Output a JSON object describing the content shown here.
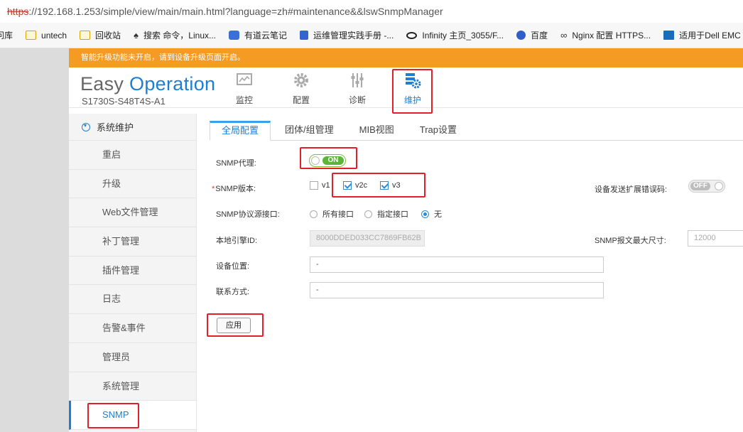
{
  "browser": {
    "url_proto": "https",
    "url_rest": "://192.168.1.253/simple/view/main/main.html?language=zh#maintenance&&lswSnmpManager",
    "bookmarks": [
      {
        "label": "问库",
        "icon": "none"
      },
      {
        "label": "untech",
        "icon": "folder-icon"
      },
      {
        "label": "回收站",
        "icon": "folder-icon"
      },
      {
        "label": "搜索 命令，Linux...",
        "icon": "linux-penguin-icon"
      },
      {
        "label": "有道云笔记",
        "icon": "youdao-note-icon"
      },
      {
        "label": "运维管理实践手册 -...",
        "icon": "document-icon"
      },
      {
        "label": "Infinity 主页_3055/F...",
        "icon": "infinity-icon"
      },
      {
        "label": "百度",
        "icon": "baidu-paw-icon"
      },
      {
        "label": "Nginx 配置 HTTPS...",
        "icon": "nginx-icon"
      },
      {
        "label": "适用于Dell EMC",
        "icon": "dell-icon"
      }
    ]
  },
  "banner": {
    "text": "智能升级功能未开启，请到设备升级页面开启。"
  },
  "header": {
    "brand_easy": "Easy",
    "brand_operation": "Operation",
    "model": "S1730S-S48T4S-A1",
    "nav": [
      {
        "label": "监控",
        "icon": "monitor-icon",
        "active": false
      },
      {
        "label": "配置",
        "icon": "gear-icon",
        "active": false
      },
      {
        "label": "诊断",
        "icon": "sliders-icon",
        "active": false
      },
      {
        "label": "维护",
        "icon": "maintenance-icon",
        "active": true
      }
    ]
  },
  "sidebar": {
    "section": "系统维护",
    "items": [
      {
        "label": "重启",
        "active": false
      },
      {
        "label": "升级",
        "active": false
      },
      {
        "label": "Web文件管理",
        "active": false
      },
      {
        "label": "补丁管理",
        "active": false
      },
      {
        "label": "插件管理",
        "active": false
      },
      {
        "label": "日志",
        "active": false
      },
      {
        "label": "告警&事件",
        "active": false
      },
      {
        "label": "管理员",
        "active": false
      },
      {
        "label": "系统管理",
        "active": false
      },
      {
        "label": "SNMP",
        "active": true
      }
    ]
  },
  "tabs": [
    {
      "label": "全局配置",
      "active": true
    },
    {
      "label": "团体/组管理",
      "active": false
    },
    {
      "label": "MIB视图",
      "active": false
    },
    {
      "label": "Trap设置",
      "active": false
    }
  ],
  "form": {
    "snmp_agent_label": "SNMP代理:",
    "snmp_agent_toggle": "ON",
    "snmp_version_required": "*",
    "snmp_version_label": "SNMP版本:",
    "versions": [
      {
        "label": "v1",
        "checked": false
      },
      {
        "label": "v2c",
        "checked": true
      },
      {
        "label": "v3",
        "checked": true
      }
    ],
    "ext_error_label": "设备发送扩展错误码:",
    "ext_error_toggle": "OFF",
    "source_iface_label": "SNMP协议源接口:",
    "source_options": [
      {
        "label": "所有接口",
        "selected": false
      },
      {
        "label": "指定接口",
        "selected": false
      },
      {
        "label": "无",
        "selected": true
      }
    ],
    "engine_id_label": "本地引擎ID:",
    "engine_id_value": "8000DDED033CC7869FB62B",
    "max_size_label": "SNMP报文最大尺寸:",
    "max_size_value": "12000",
    "location_label": "设备位置:",
    "location_value": "-",
    "contact_label": "联系方式:",
    "contact_value": "-",
    "apply_label": "应用"
  },
  "colors": {
    "accent": "#1e7ed3",
    "banner": "#f59a23",
    "highlight_box": "#e0212b",
    "toggle_on": "#5bb538"
  }
}
